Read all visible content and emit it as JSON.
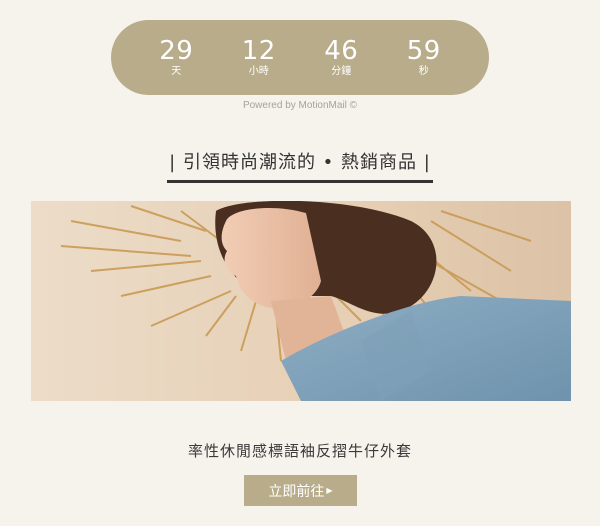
{
  "countdown": {
    "days": {
      "value": "29",
      "label": "天"
    },
    "hours": {
      "value": "12",
      "label": "小時"
    },
    "minutes": {
      "value": "46",
      "label": "分鐘"
    },
    "seconds": {
      "value": "59",
      "label": "秒"
    }
  },
  "powered_by": "Powered by MotionMail ©",
  "section_heading": "| 引領時尚潮流的 • 熱銷商品 |",
  "product": {
    "name": "率性休閒感標語袖反摺牛仔外套",
    "cta_label": "立即前往",
    "cta_icon": "triangle-right-icon"
  },
  "colors": {
    "accent": "#b8ac8b",
    "background": "#f6f2ec",
    "text": "#333333"
  }
}
